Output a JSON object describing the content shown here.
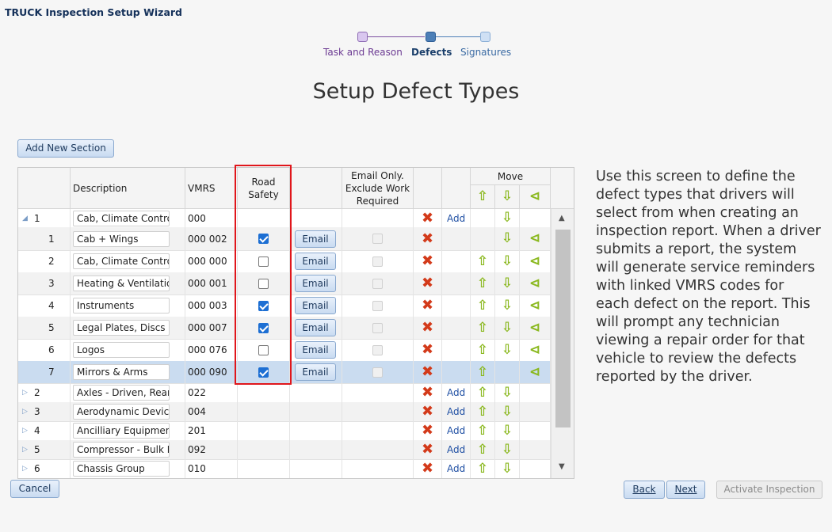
{
  "window": {
    "title": "TRUCK Inspection Setup Wizard"
  },
  "stepper": {
    "steps": [
      "Task and Reason",
      "Defects",
      "Signatures"
    ],
    "active_step": "Defects"
  },
  "page": {
    "title": "Setup Defect Types"
  },
  "toolbar": {
    "add_section_label": "Add New Section"
  },
  "grid": {
    "headers": {
      "description": "Description",
      "vmrs": "VMRS",
      "road_safety": "Road Safety",
      "email_only": "Email Only. Exclude Work Required",
      "move": "Move"
    },
    "email_label": "Email",
    "add_label": "Add",
    "sections": [
      {
        "number": "1",
        "description": "Cab, Climate Control",
        "vmrs": "000",
        "expanded": true,
        "items": [
          {
            "number": "1",
            "description": "Cab + Wings",
            "vmrs": "000 002",
            "road_safety": true
          },
          {
            "number": "2",
            "description": "Cab, Climate Control",
            "vmrs": "000 000",
            "road_safety": false
          },
          {
            "number": "3",
            "description": "Heating & Ventilation",
            "vmrs": "000 001",
            "road_safety": false
          },
          {
            "number": "4",
            "description": "Instruments",
            "vmrs": "000 003",
            "road_safety": true
          },
          {
            "number": "5",
            "description": "Legal Plates, Discs &",
            "vmrs": "000 007",
            "road_safety": true
          },
          {
            "number": "6",
            "description": "Logos",
            "vmrs": "000 076",
            "road_safety": false
          },
          {
            "number": "7",
            "description": "Mirrors & Arms",
            "vmrs": "000 090",
            "road_safety": true,
            "selected": true
          }
        ]
      },
      {
        "number": "2",
        "description": "Axles - Driven, Rear",
        "vmrs": "022",
        "expanded": false
      },
      {
        "number": "3",
        "description": "Aerodynamic Devices",
        "vmrs": "004",
        "expanded": false
      },
      {
        "number": "4",
        "description": "Ancilliary Equipment",
        "vmrs": "201",
        "expanded": false
      },
      {
        "number": "5",
        "description": "Compressor - Bulk P",
        "vmrs": "092",
        "expanded": false
      },
      {
        "number": "6",
        "description": "Chassis Group",
        "vmrs": "010",
        "expanded": false
      }
    ]
  },
  "help_text": "Use this screen to define the defect types that drivers will select from when creating an inspection report. When a driver submits a report, the system will generate service reminders with linked VMRS codes for each defect on the report. This will prompt any technician viewing a repair order for that vehicle to review the defects reported by the driver.",
  "footer": {
    "cancel": "Cancel",
    "back": "Back",
    "next": "Next",
    "activate": "Activate Inspection"
  },
  "colors": {
    "accent": "#1d6fd3",
    "highlight_border": "#e0161b",
    "arrow_green": "#8ab81e",
    "delete_red": "#d33a1a",
    "step_done": "#d9c7ef",
    "step_active": "#4d7fb7"
  }
}
